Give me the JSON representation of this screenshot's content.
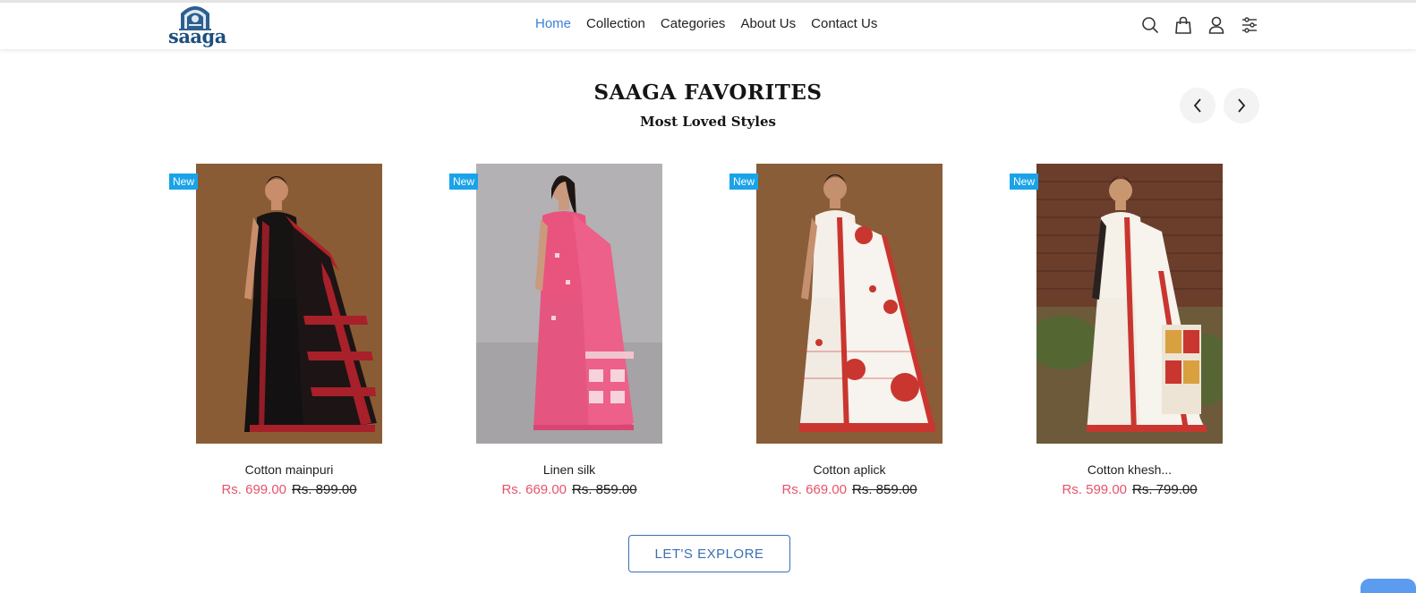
{
  "header": {
    "logo_text": "saaga",
    "nav": [
      {
        "label": "Home",
        "active": true
      },
      {
        "label": "Collection",
        "active": false
      },
      {
        "label": "Categories",
        "active": false
      },
      {
        "label": "About Us",
        "active": false
      },
      {
        "label": "Contact Us",
        "active": false
      }
    ],
    "icons": [
      "search-icon",
      "shopping-bag-icon",
      "user-icon",
      "filter-sliders-icon"
    ],
    "accent_color": "#3b7fd8"
  },
  "section": {
    "title": "SAAGA FAVORITES",
    "subtitle": "Most Loved Styles"
  },
  "products": [
    {
      "badge": "New",
      "name": "Cotton mainpuri",
      "sale_price": "Rs. 699.00",
      "original_price": "Rs. 899.00"
    },
    {
      "badge": "New",
      "name": "Linen silk",
      "sale_price": "Rs. 669.00",
      "original_price": "Rs. 859.00"
    },
    {
      "badge": "New",
      "name": "Cotton aplick",
      "sale_price": "Rs. 669.00",
      "original_price": "Rs. 859.00"
    },
    {
      "badge": "New",
      "name": "Cotton khesh...",
      "sale_price": "Rs. 599.00",
      "original_price": "Rs. 799.00"
    }
  ],
  "cta": {
    "label": "LET'S EXPLORE"
  },
  "colors": {
    "sale": "#e6536b",
    "badge": "#1aa3e8",
    "button_border": "#3b6fb2"
  }
}
